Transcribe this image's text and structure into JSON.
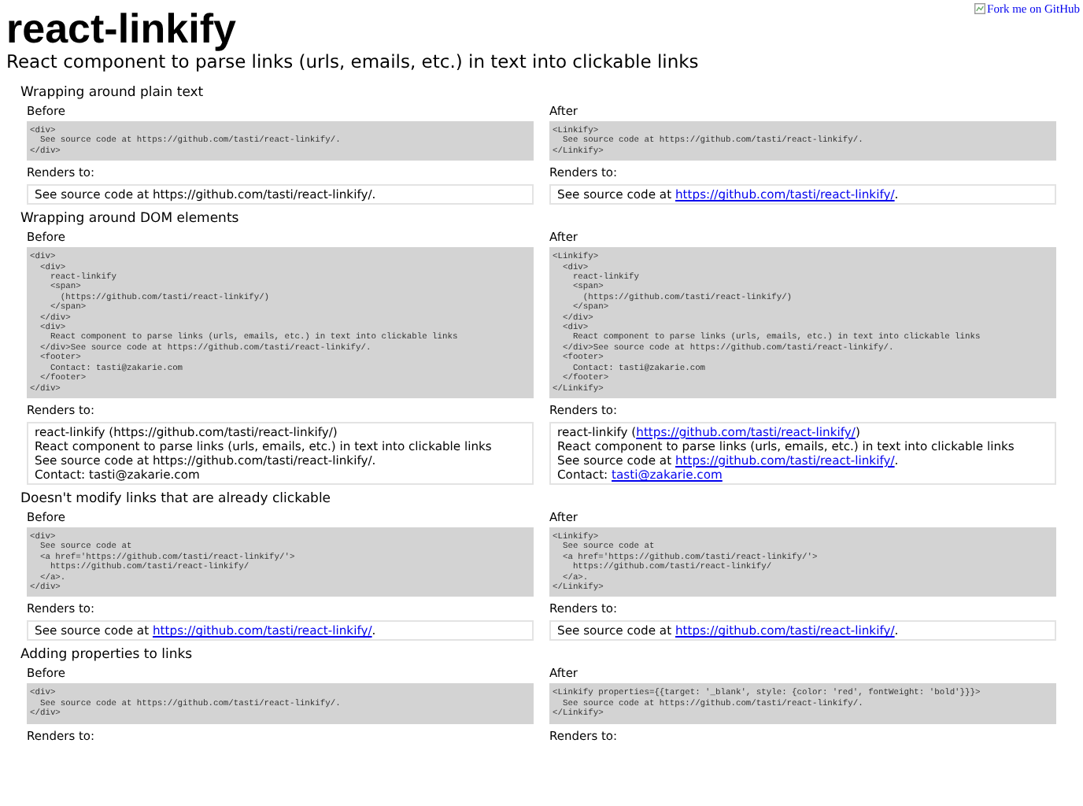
{
  "title": "react-linkify",
  "subtitle": "React component to parse links (urls, emails, etc.) in text into clickable links",
  "fork_ribbon": {
    "alt": "Fork me on GitHub"
  },
  "sections": [
    {
      "heading": "Wrapping around plain text",
      "columns": [
        {
          "label": "Before",
          "code": [
            "<div>",
            "  See source code at https://github.com/tasti/react-linkify/.",
            "</div>"
          ],
          "renders_label": "Renders to:",
          "output": [
            [
              {
                "kind": "text",
                "text": "See source code at https://github.com/tasti/react-linkify/."
              }
            ]
          ]
        },
        {
          "label": "After",
          "code": [
            "<Linkify>",
            "  See source code at https://github.com/tasti/react-linkify/.",
            "</Linkify>"
          ],
          "renders_label": "Renders to:",
          "output": [
            [
              {
                "kind": "text",
                "text": "See source code at "
              },
              {
                "kind": "link",
                "text": "https://github.com/tasti/react-linkify/"
              },
              {
                "kind": "text",
                "text": "."
              }
            ]
          ]
        }
      ]
    },
    {
      "heading": "Wrapping around DOM elements",
      "columns": [
        {
          "label": "Before",
          "code": [
            "<div>",
            "  <div>",
            "    react-linkify",
            "    <span>",
            "      (https://github.com/tasti/react-linkify/)",
            "    </span>",
            "  </div>",
            "  <div>",
            "    React component to parse links (urls, emails, etc.) in text into clickable links",
            "  </div>See source code at https://github.com/tasti/react-linkify/.",
            "  <footer>",
            "    Contact: tasti@zakarie.com",
            "  </footer>",
            "</div>"
          ],
          "renders_label": "Renders to:",
          "output": [
            [
              {
                "kind": "text",
                "text": "react-linkify (https://github.com/tasti/react-linkify/)"
              }
            ],
            [
              {
                "kind": "text",
                "text": "React component to parse links (urls, emails, etc.) in text into clickable links"
              }
            ],
            [
              {
                "kind": "text",
                "text": "See source code at https://github.com/tasti/react-linkify/."
              }
            ],
            [
              {
                "kind": "text",
                "text": "Contact: tasti@zakarie.com"
              }
            ]
          ]
        },
        {
          "label": "After",
          "code": [
            "<Linkify>",
            "  <div>",
            "    react-linkify",
            "    <span>",
            "      (https://github.com/tasti/react-linkify/)",
            "    </span>",
            "  </div>",
            "  <div>",
            "    React component to parse links (urls, emails, etc.) in text into clickable links",
            "  </div>See source code at https://github.com/tasti/react-linkify/.",
            "  <footer>",
            "    Contact: tasti@zakarie.com",
            "  </footer>",
            "</Linkify>"
          ],
          "renders_label": "Renders to:",
          "output": [
            [
              {
                "kind": "text",
                "text": "react-linkify ("
              },
              {
                "kind": "link",
                "text": "https://github.com/tasti/react-linkify/"
              },
              {
                "kind": "text",
                "text": ")"
              }
            ],
            [
              {
                "kind": "text",
                "text": "React component to parse links (urls, emails, etc.) in text into clickable links"
              }
            ],
            [
              {
                "kind": "text",
                "text": "See source code at "
              },
              {
                "kind": "link",
                "text": "https://github.com/tasti/react-linkify/"
              },
              {
                "kind": "text",
                "text": "."
              }
            ],
            [
              {
                "kind": "text",
                "text": "Contact: "
              },
              {
                "kind": "link",
                "text": "tasti@zakarie.com"
              }
            ]
          ]
        }
      ]
    },
    {
      "heading": "Doesn't modify links that are already clickable",
      "columns": [
        {
          "label": "Before",
          "code": [
            "<div>",
            "  See source code at",
            "  <a href='https://github.com/tasti/react-linkify/'>",
            "    https://github.com/tasti/react-linkify/",
            "  </a>.",
            "</div>"
          ],
          "renders_label": "Renders to:",
          "output": [
            [
              {
                "kind": "text",
                "text": "See source code at "
              },
              {
                "kind": "link",
                "text": "https://github.com/tasti/react-linkify/"
              },
              {
                "kind": "text",
                "text": "."
              }
            ]
          ]
        },
        {
          "label": "After",
          "code": [
            "<Linkify>",
            "  See source code at",
            "  <a href='https://github.com/tasti/react-linkify/'>",
            "    https://github.com/tasti/react-linkify/",
            "  </a>.",
            "</Linkify>"
          ],
          "renders_label": "Renders to:",
          "output": [
            [
              {
                "kind": "text",
                "text": "See source code at "
              },
              {
                "kind": "link",
                "text": "https://github.com/tasti/react-linkify/"
              },
              {
                "kind": "text",
                "text": "."
              }
            ]
          ]
        }
      ]
    },
    {
      "heading": "Adding properties to links",
      "columns": [
        {
          "label": "Before",
          "code": [
            "<div>",
            "  See source code at https://github.com/tasti/react-linkify/.",
            "</div>"
          ],
          "renders_label": "Renders to:"
        },
        {
          "label": "After",
          "code": [
            "<Linkify properties={{target: '_blank', style: {color: 'red', fontWeight: 'bold'}}}>",
            "  See source code at https://github.com/tasti/react-linkify/.",
            "</Linkify>"
          ],
          "renders_label": "Renders to:"
        }
      ]
    }
  ]
}
